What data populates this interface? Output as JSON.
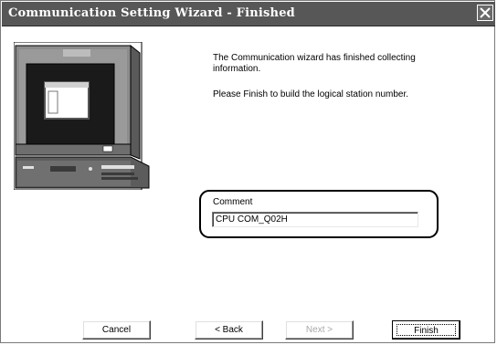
{
  "window": {
    "title": "Communication Setting Wizard - Finished"
  },
  "titlebar_icons": [
    "close-icon"
  ],
  "illustration": {
    "icon": "computer-monitor-icon"
  },
  "message": {
    "line1": "The Communication wizard has finished collecting",
    "line2": "information.",
    "line3": "Please Finish to build the logical station number."
  },
  "comment": {
    "label": "Comment",
    "value": "CPU COM_Q02H"
  },
  "buttons": {
    "cancel": "Cancel",
    "back": "< Back",
    "next": "Next >",
    "finish": "Finish"
  },
  "colors": {
    "titlebar": "#575757",
    "highlight_border": "#000000",
    "disabled_text": "#a8a8a8"
  }
}
